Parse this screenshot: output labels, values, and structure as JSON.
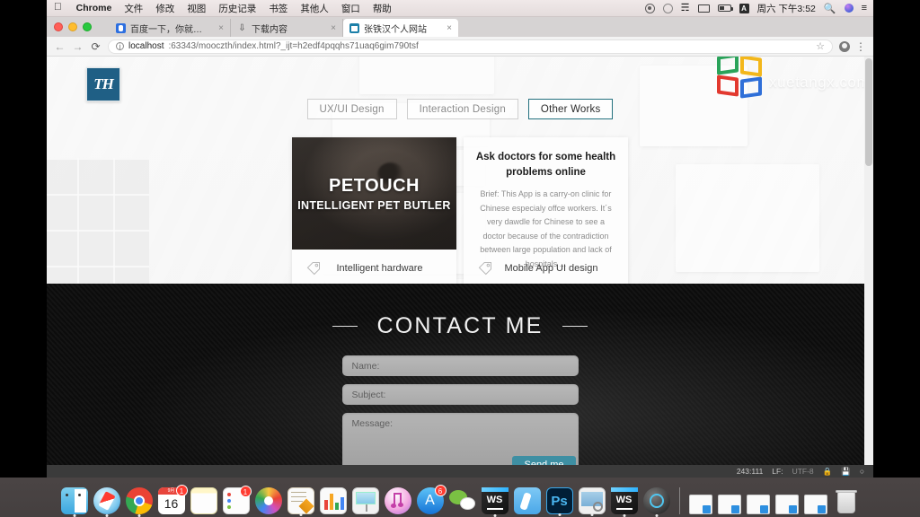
{
  "menubar": {
    "apple": "apple-logo",
    "items": [
      "Chrome",
      "文件",
      "修改",
      "视图",
      "历史记录",
      "书签",
      "其他人",
      "窗口",
      "帮助"
    ],
    "time": "周六 下午3:52"
  },
  "browser": {
    "tabs": [
      {
        "title": "百度一下，你就知道",
        "active": false
      },
      {
        "title": "下载内容",
        "active": false
      },
      {
        "title": "张铁汉个人网站",
        "active": true
      }
    ],
    "omnibox": {
      "host": "localhost",
      "rest": ":63343/mooczth/index.html?_ijt=h2edf4pqqhs71uaq6gim790tsf"
    }
  },
  "site": {
    "logo_text": "TH",
    "watermark": "xuetangx.com",
    "tabs": [
      {
        "label": "UX/UI Design",
        "active": false
      },
      {
        "label": "Interaction Design",
        "active": false
      },
      {
        "label": "Other Works",
        "active": true
      }
    ],
    "cards": [
      {
        "overlay_title": "PETOUCH",
        "overlay_subtitle": "INTELLIGENT PET BUTLER",
        "footer": "Intelligent hardware"
      },
      {
        "title": "Ask doctors for some health problems online",
        "brief": "Brief: This App is a carry-on clinic for Chinese especialy offce workers. It´s very dawdle for Chinese to see a doctor because of the contradiction between large population and lack of hospitals ...",
        "footer": "Mobile App UI design"
      }
    ],
    "contact": {
      "heading": "CONTACT ME",
      "fields": [
        {
          "label": "Name:"
        },
        {
          "label": "Subject:"
        },
        {
          "label": "Message:"
        }
      ],
      "submit": "Send me"
    }
  },
  "ide_status": {
    "caret": "243:111",
    "line_sep": "LF:",
    "encoding": "UTF-8"
  },
  "colors": {
    "accent_teal": "#23707e",
    "send_button": "#3e8fa3",
    "logo_blue": "#1f5f85",
    "dark_section": "#0a0a0a"
  }
}
